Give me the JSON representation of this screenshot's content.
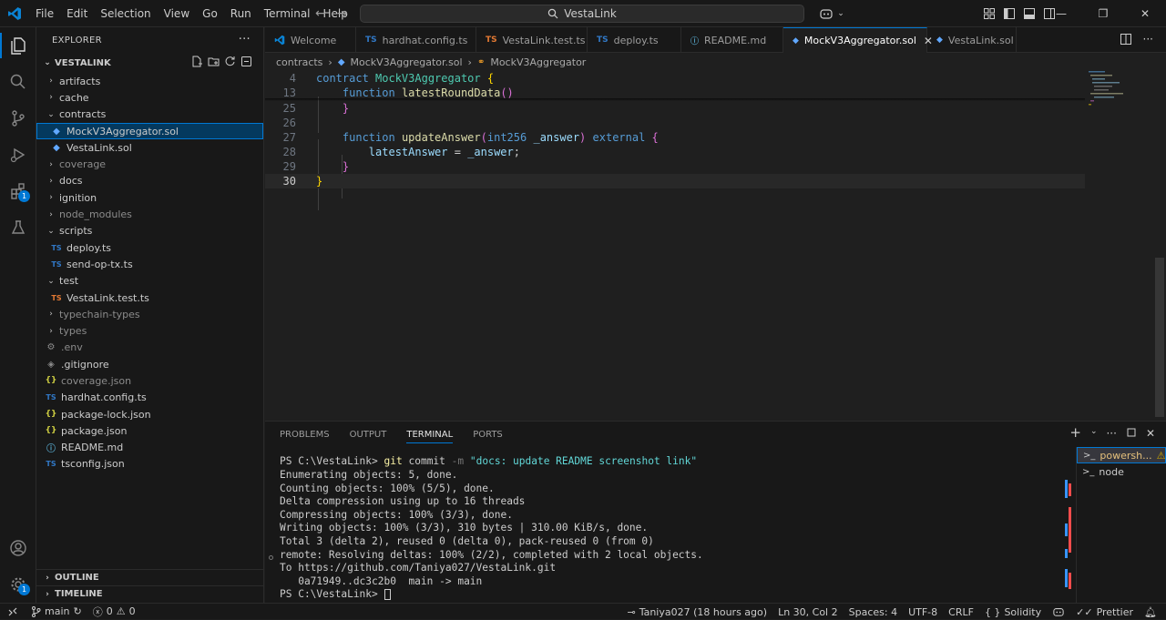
{
  "titlebar": {
    "menu": [
      "File",
      "Edit",
      "Selection",
      "View",
      "Go",
      "Run",
      "Terminal",
      "Help"
    ],
    "search_text": "VestaLink"
  },
  "explorer": {
    "title": "EXPLORER",
    "root": "VESTALINK",
    "items": [
      {
        "label": "artifacts"
      },
      {
        "label": "cache"
      },
      {
        "label": "contracts"
      },
      {
        "label": "MockV3Aggregator.sol"
      },
      {
        "label": "VestaLink.sol"
      },
      {
        "label": "coverage"
      },
      {
        "label": "docs"
      },
      {
        "label": "ignition"
      },
      {
        "label": "node_modules"
      },
      {
        "label": "scripts"
      },
      {
        "label": "deploy.ts"
      },
      {
        "label": "send-op-tx.ts"
      },
      {
        "label": "test"
      },
      {
        "label": "VestaLink.test.ts"
      },
      {
        "label": "typechain-types"
      },
      {
        "label": "types"
      },
      {
        "label": ".env"
      },
      {
        "label": ".gitignore"
      },
      {
        "label": "coverage.json"
      },
      {
        "label": "hardhat.config.ts"
      },
      {
        "label": "package-lock.json"
      },
      {
        "label": "package.json"
      },
      {
        "label": "README.md"
      },
      {
        "label": "tsconfig.json"
      }
    ],
    "outline": "OUTLINE",
    "timeline": "TIMELINE",
    "badge_count": "1"
  },
  "tabs": [
    {
      "label": "Welcome",
      "icon": "vscode-icon"
    },
    {
      "label": "hardhat.config.ts",
      "icon": "TS"
    },
    {
      "label": "VestaLink.test.ts",
      "icon": "TS"
    },
    {
      "label": "deploy.ts",
      "icon": "TS"
    },
    {
      "label": "README.md",
      "icon": "info-icon"
    },
    {
      "label": "MockV3Aggregator.sol",
      "icon": "solidity-icon"
    },
    {
      "label": "VestaLink.sol",
      "icon": "solidity-icon"
    }
  ],
  "breadcrumb": {
    "folder": "contracts",
    "file": "MockV3Aggregator.sol",
    "symbol": "MockV3Aggregator"
  },
  "code": {
    "line_numbers": [
      "4",
      "13",
      "25",
      "26",
      "27",
      "28",
      "29",
      "30"
    ],
    "l4": {
      "kw": "contract",
      "name": "MockV3Aggregator",
      "brace": "{"
    },
    "l13": {
      "kw": "function",
      "name": "latestRoundData",
      "parens": "()"
    },
    "l25": "}",
    "l27": {
      "kw": "function",
      "name": "updateAnswer",
      "open": "(",
      "type": "int256",
      "param": "_answer",
      "close": ")",
      "mod": "external",
      "brace": "{"
    },
    "l28": {
      "lhs": "latestAnswer",
      "op": " = ",
      "rhs": "_answer",
      "end": ";"
    },
    "l29": "}",
    "l30": "}"
  },
  "panel": {
    "tabs": [
      "PROBLEMS",
      "OUTPUT",
      "TERMINAL",
      "PORTS"
    ],
    "terminal": {
      "prompt": "PS C:\\VestaLink> ",
      "cmd": "git",
      "sub": "commit",
      "flag": "-m",
      "msg": "\"docs: update README screenshot link\"",
      "lines": [
        "Enumerating objects: 5, done.",
        "Counting objects: 100% (5/5), done.",
        "Delta compression using up to 16 threads",
        "Compressing objects: 100% (3/3), done.",
        "Writing objects: 100% (3/3), 310 bytes | 310.00 KiB/s, done.",
        "Total 3 (delta 2), reused 0 (delta 0), pack-reused 0 (from 0)",
        "remote: Resolving deltas: 100% (2/2), completed with 2 local objects.",
        "To https://github.com/Taniya027/VestaLink.git",
        "   0a71949..dc3c2b0  main -> main"
      ],
      "final_prompt": "PS C:\\VestaLink> "
    },
    "terminal_list": [
      "powersh...",
      "node"
    ]
  },
  "statusbar": {
    "branch": "main",
    "errors": "0",
    "warnings": "0",
    "blame": "Taniya027 (18 hours ago)",
    "position": "Ln 30, Col 2",
    "spaces": "Spaces: 4",
    "encoding": "UTF-8",
    "eol": "CRLF",
    "language": "Solidity",
    "formatter": "Prettier"
  }
}
